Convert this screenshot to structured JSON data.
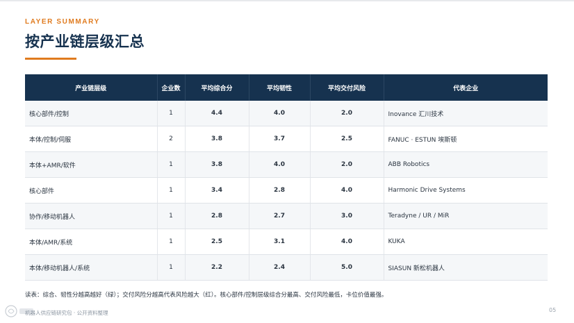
{
  "header": {
    "eyebrow": "LAYER SUMMARY",
    "title": "按产业链层级汇总"
  },
  "table": {
    "columns": [
      "产业链层级",
      "企业数",
      "平均综合分",
      "平均韧性",
      "平均交付风险",
      "代表企业"
    ],
    "rows": [
      {
        "layer": "核心部件/控制",
        "count": "1",
        "composite": "4.4",
        "composite_tone": "green",
        "resilience": "4.0",
        "resilience_tone": "green",
        "delivery_risk": "2.0",
        "delivery_risk_tone": "green",
        "companies": "Inovance 汇川技术"
      },
      {
        "layer": "本体/控制/伺服",
        "count": "2",
        "composite": "3.8",
        "composite_tone": "amber",
        "resilience": "3.7",
        "resilience_tone": "amber",
        "delivery_risk": "2.5",
        "delivery_risk_tone": "amber",
        "companies": "FANUC · ESTUN 埃斯顿"
      },
      {
        "layer": "本体+AMR/软件",
        "count": "1",
        "composite": "3.8",
        "composite_tone": "amber",
        "resilience": "4.0",
        "resilience_tone": "green",
        "delivery_risk": "2.0",
        "delivery_risk_tone": "green",
        "companies": "ABB Robotics"
      },
      {
        "layer": "核心部件",
        "count": "1",
        "composite": "3.4",
        "composite_tone": "amber",
        "resilience": "2.8",
        "resilience_tone": "red",
        "delivery_risk": "4.0",
        "delivery_risk_tone": "red",
        "companies": "Harmonic Drive Systems"
      },
      {
        "layer": "协作/移动机器人",
        "count": "1",
        "composite": "2.8",
        "composite_tone": "red",
        "resilience": "2.7",
        "resilience_tone": "red",
        "delivery_risk": "3.0",
        "delivery_risk_tone": "amber",
        "companies": "Teradyne / UR / MiR"
      },
      {
        "layer": "本体/AMR/系统",
        "count": "1",
        "composite": "2.5",
        "composite_tone": "red",
        "resilience": "3.1",
        "resilience_tone": "amber",
        "delivery_risk": "4.0",
        "delivery_risk_tone": "red",
        "companies": "KUKA"
      },
      {
        "layer": "本体/移动机器人/系统",
        "count": "1",
        "composite": "2.2",
        "composite_tone": "red",
        "resilience": "2.4",
        "resilience_tone": "red",
        "delivery_risk": "5.0",
        "delivery_risk_tone": "red",
        "companies": "SIASUN 新松机器人"
      }
    ]
  },
  "colors": {
    "green": "#3a7a4a",
    "amber": "#c9962a",
    "red": "#b83a30",
    "header_bg": "#16324f",
    "accent": "#e07b1f"
  },
  "note": "读表：综合、韧性分越高越好（绿）；交付风险分越高代表风险越大（红）。核心部件/控制层级综合分最高、交付风险最低，卡位价值最强。",
  "footer": {
    "source": "机器人供应链研究包 · 公开资料整理",
    "page": "05"
  }
}
